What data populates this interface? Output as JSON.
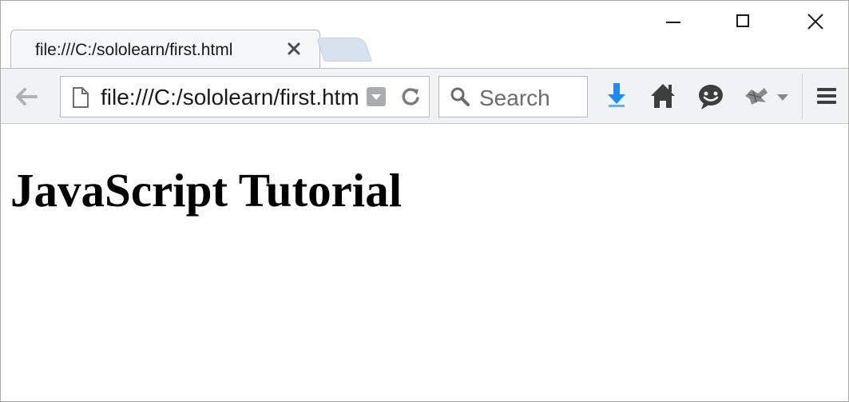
{
  "window": {
    "controls": {
      "minimize": "minimize-icon",
      "maximize": "maximize-icon",
      "close": "close-icon"
    }
  },
  "tabs": [
    {
      "title": "file:///C:/sololearn/first.html",
      "close_icon": "close-icon",
      "active": true
    }
  ],
  "navbar": {
    "back_icon": "back-arrow-icon",
    "url": "file:///C:/sololearn/first.html",
    "reload_icon": "reload-icon",
    "search_placeholder": "Search",
    "toolbar_icons": [
      "download-icon",
      "home-icon",
      "chat-icon",
      "extension-icon",
      "hamburger-menu-icon"
    ],
    "accent_color": "#1a8cff"
  },
  "page": {
    "heading": "JavaScript Tutorial"
  }
}
